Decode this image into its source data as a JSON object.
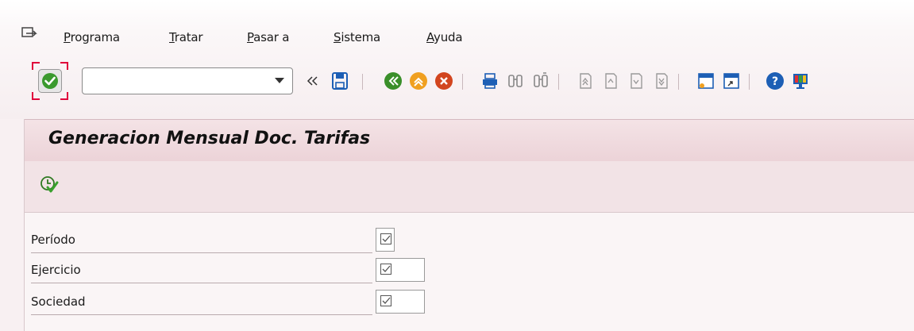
{
  "menu": {
    "items": [
      {
        "label": "Programa",
        "mnemonic": "P",
        "rest": "rograma"
      },
      {
        "label": "Tratar",
        "mnemonic": "T",
        "rest": "ratar"
      },
      {
        "label": "Pasar a",
        "mnemonic": "P",
        "rest": "asar a"
      },
      {
        "label": "Sistema",
        "mnemonic": "S",
        "rest": "istema"
      },
      {
        "label": "Ayuda",
        "mnemonic": "A",
        "rest": "yuda"
      }
    ]
  },
  "toolbar": {
    "command_value": "",
    "icons": [
      "ok-icon",
      "collapse-icon",
      "save-icon",
      "back-icon",
      "exit-icon",
      "cancel-icon",
      "print-icon",
      "find-icon",
      "find-next-icon",
      "first-page-icon",
      "previous-page-icon",
      "next-page-icon",
      "last-page-icon",
      "new-session-icon",
      "shortcut-icon",
      "help-icon",
      "layout-menu-icon"
    ]
  },
  "screen": {
    "title": "Generacion Mensual Doc. Tarifas",
    "execute_icon": "execute-icon"
  },
  "fields": [
    {
      "label": "Período",
      "value": "",
      "required": true
    },
    {
      "label": "Ejercicio",
      "value": "",
      "required": true
    },
    {
      "label": "Sociedad",
      "value": "",
      "required": true
    }
  ],
  "colors": {
    "title_bar": "#ecd3d8",
    "ok_green": "#3a9a2e",
    "focus_red": "#e0003a"
  }
}
